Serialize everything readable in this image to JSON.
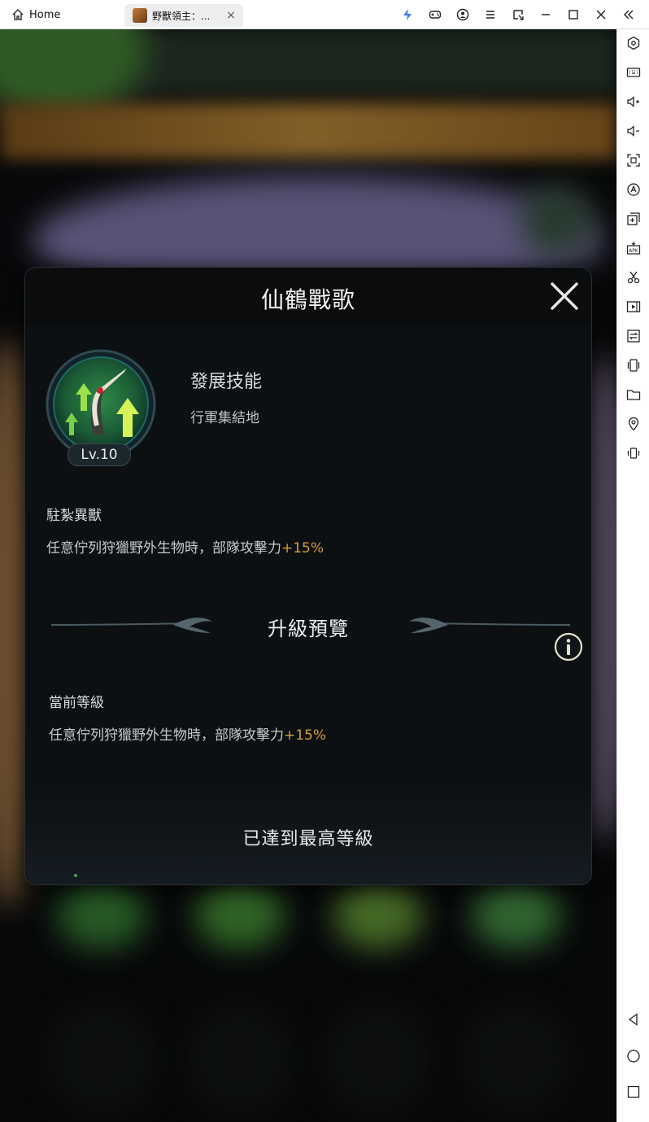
{
  "titlebar": {
    "home_label": "Home",
    "tab_label": "野獸領主：...",
    "tab_close": "×",
    "icons": [
      "bolt-icon",
      "gamepad-icon",
      "account-icon",
      "menu-icon",
      "popout-icon",
      "minimize-icon",
      "maximize-icon",
      "close-icon",
      "collapse-icon"
    ]
  },
  "sidebar": {
    "icons": [
      "settings-hex-icon",
      "keyboard-icon",
      "volume-up-icon",
      "volume-down-icon",
      "screenshot-icon",
      "auto-icon",
      "multi-instance-icon",
      "apk-install-icon",
      "cut-icon",
      "record-icon",
      "sync-icon",
      "shake-icon",
      "folder-icon",
      "location-icon",
      "rotate-icon",
      "back-nav-icon",
      "home-nav-icon",
      "recents-nav-icon"
    ]
  },
  "modal": {
    "title": "仙鶴戰歌",
    "close": "close",
    "level": "Lv.10",
    "skill_type": "發展技能",
    "skill_subtype": "行軍集結地",
    "section1_label": "駐紮異獸",
    "section1_desc": "任意佇列狩獵野外生物時，部隊攻擊力",
    "section1_plus": "+15%",
    "preview_title": "升級預覽",
    "current_label": "當前等級",
    "current_desc": "任意佇列狩獵野外生物時，部隊攻擊力",
    "current_plus": "+15%",
    "max_level_text": "已達到最高等級"
  },
  "colors": {
    "accent_gold": "#d79c3b",
    "panel_bg": "#0d1013",
    "skill_green": "#3ba24a"
  }
}
